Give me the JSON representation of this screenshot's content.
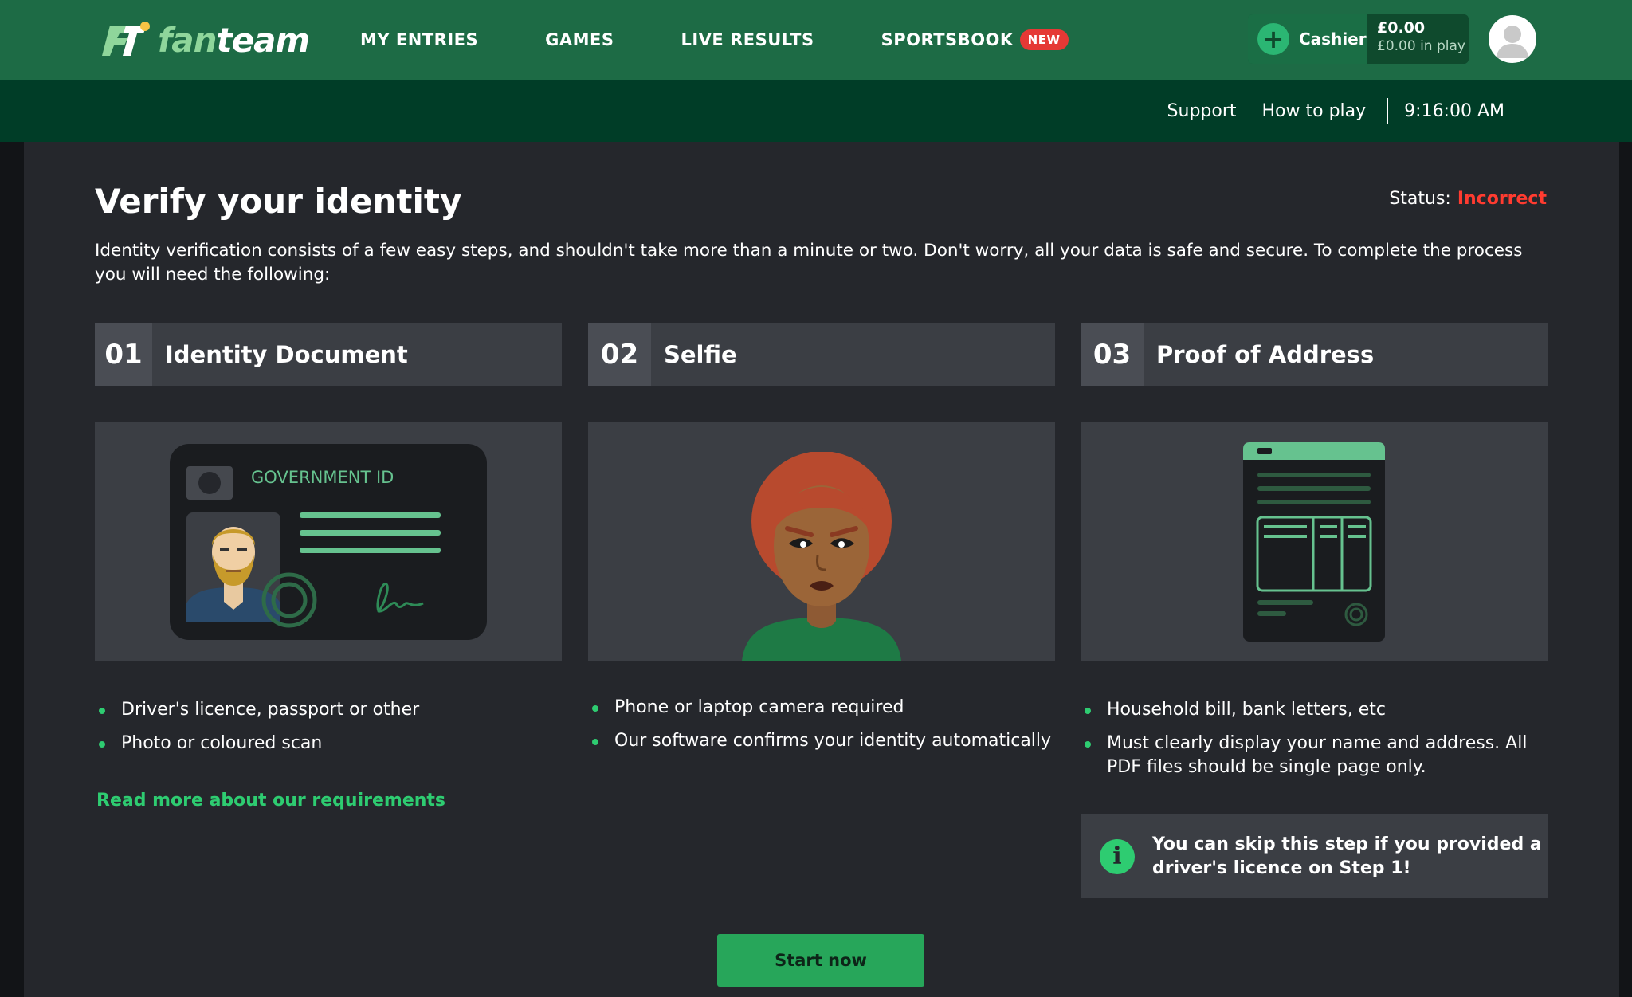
{
  "header": {
    "logo_text_prefix": "fan",
    "logo_text_suffix": "team",
    "nav": [
      {
        "label": "MY ENTRIES"
      },
      {
        "label": "GAMES"
      },
      {
        "label": "LIVE RESULTS"
      },
      {
        "label": "SPORTSBOOK",
        "badge": "NEW"
      }
    ],
    "cashier_label": "Cashier",
    "balance": "£0.00",
    "balance_in_play": "£0.00 in play"
  },
  "subnav": {
    "support": "Support",
    "how_to_play": "How to play",
    "time": "9:16:00 AM"
  },
  "page": {
    "title": "Verify your identity",
    "status_label": "Status:",
    "status_value": "Incorrect",
    "intro": "Identity verification consists of a few easy steps, and shouldn't take more than a minute or two. Don't worry, all your data is safe and secure. To complete the process you will need the following:"
  },
  "steps": [
    {
      "num": "01",
      "title": "Identity Document",
      "illustration_label": "GOVERNMENT ID",
      "bullets": [
        "Driver's licence, passport or other",
        "Photo or coloured scan"
      ]
    },
    {
      "num": "02",
      "title": "Selfie",
      "bullets": [
        "Phone or laptop camera required",
        "Our software confirms your identity automatically"
      ]
    },
    {
      "num": "03",
      "title": "Proof of Address",
      "bullets": [
        "Household bill, bank letters, etc",
        "Must clearly display your name and address. All PDF files should be single page only."
      ]
    }
  ],
  "read_more": "Read more about our requirements",
  "info": {
    "icon": "i",
    "text": "You can skip this step if you provided a driver's licence on Step 1!"
  },
  "start_button": "Start now",
  "colors": {
    "brand_green": "#1d6b45",
    "dark_green": "#003d27",
    "accent_green": "#2ecc71",
    "status_red": "#ff3b30"
  }
}
